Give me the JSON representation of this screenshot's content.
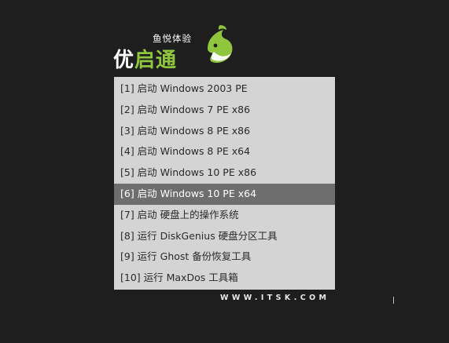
{
  "logo": {
    "tagline": "鱼悦体验",
    "name_part1": "优",
    "name_part2": "启通",
    "icon": "fish-logo-icon",
    "colors": {
      "green": "#8fc63e",
      "white": "#ffffff"
    }
  },
  "menu": {
    "selected_index": 5,
    "items": [
      {
        "label": "[1] 启动 Windows 2003 PE"
      },
      {
        "label": "[2] 启动 Windows 7 PE x86"
      },
      {
        "label": "[3] 启动 Windows 8 PE x86"
      },
      {
        "label": "[4] 启动 Windows 8 PE x64"
      },
      {
        "label": "[5] 启动 Windows 10 PE x86"
      },
      {
        "label": "[6] 启动 Windows 10 PE x64"
      },
      {
        "label": "[7] 启动 硬盘上的操作系统"
      },
      {
        "label": "[8] 运行 DiskGenius 硬盘分区工具"
      },
      {
        "label": "[9] 运行 Ghost 备份恢复工具"
      },
      {
        "label": "[10] 运行 MaxDos 工具箱"
      }
    ],
    "colors": {
      "background": "#d4d4d4",
      "selected": "#6e6e6e",
      "text": "#2a2a2a"
    }
  },
  "footer": {
    "url": "WWW.ITSK.COM"
  },
  "theme": {
    "background": "#1e1e1e"
  }
}
